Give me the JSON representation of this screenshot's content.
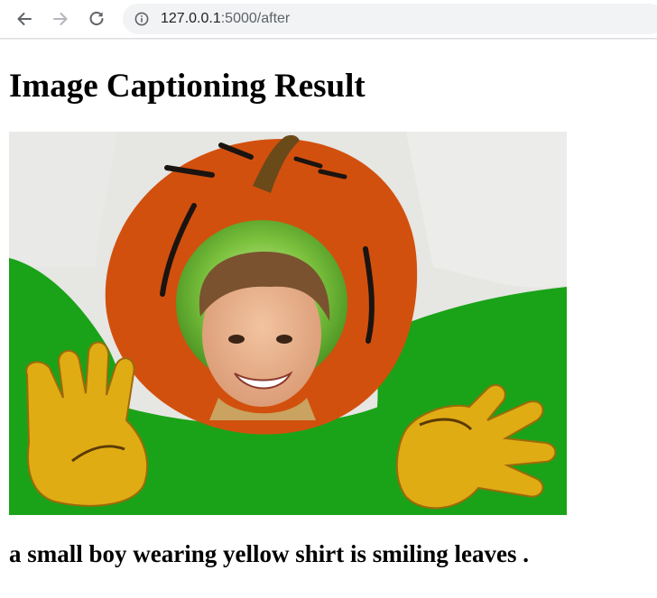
{
  "browser": {
    "url_host": "127.0.0.1",
    "url_rest": ":5000/after",
    "icons": {
      "back": "back-arrow-icon",
      "forward": "forward-arrow-icon",
      "reload": "reload-icon",
      "site_info": "info-icon"
    }
  },
  "page": {
    "title": "Image Captioning Result",
    "caption": "a small boy wearing yellow shirt is smiling leaves ."
  },
  "colors": {
    "pumpkin": "#d2500e",
    "leaves": "#1aa318",
    "hands": "#e0ac14",
    "board": "#e6e6e3"
  }
}
